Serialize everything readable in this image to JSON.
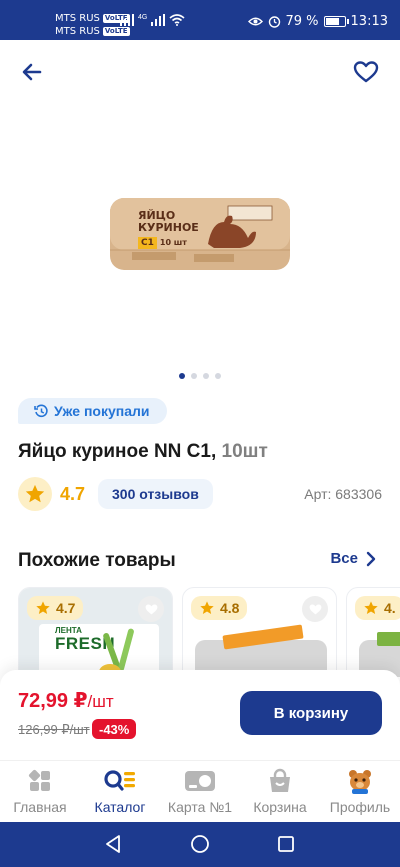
{
  "status_bar": {
    "carrier1": "MTS RUS",
    "carrier2": "MTS RUS",
    "volte": "VoLTE",
    "network": "4G",
    "battery": "79 %",
    "battery_level": 0.79,
    "time": "13:13"
  },
  "product": {
    "bought_label": "Уже покупали",
    "title": "Яйцо куриное NN C1, ",
    "title_qty": "10шт",
    "rating": "4.7",
    "reviews": "300 отзывов",
    "article": "Арт: 683306",
    "image_count": 4,
    "image_active": 1,
    "package_text_1": "ЯЙЦО",
    "package_text_2": "КУРИНОЕ",
    "package_grade": "С1",
    "package_qty": "10 шт"
  },
  "similar": {
    "title": "Похожие товары",
    "all_label": "Все",
    "items": [
      {
        "rating": "4.7",
        "brand": "ЛЕНТА",
        "brand_sub": "FRESH"
      },
      {
        "rating": "4.8"
      },
      {
        "rating": "4."
      }
    ]
  },
  "purchase": {
    "price": "72,99 ₽",
    "price_unit": "/шт",
    "old_price": "126,99 ₽/шт",
    "discount": "-43%",
    "cart_button": "В корзину"
  },
  "nav": {
    "items": [
      {
        "label": "Главная",
        "icon": "home-icon"
      },
      {
        "label": "Каталог",
        "icon": "catalog-icon"
      },
      {
        "label": "Карта №1",
        "icon": "card-icon"
      },
      {
        "label": "Корзина",
        "icon": "cart-icon"
      },
      {
        "label": "Профиль",
        "icon": "profile-icon"
      }
    ],
    "active": "Каталог"
  },
  "colors": {
    "brand": "#1d3a8f",
    "price_red": "#e4132d",
    "rating_gold": "#f0a500",
    "bought_blue": "#2474d6"
  }
}
